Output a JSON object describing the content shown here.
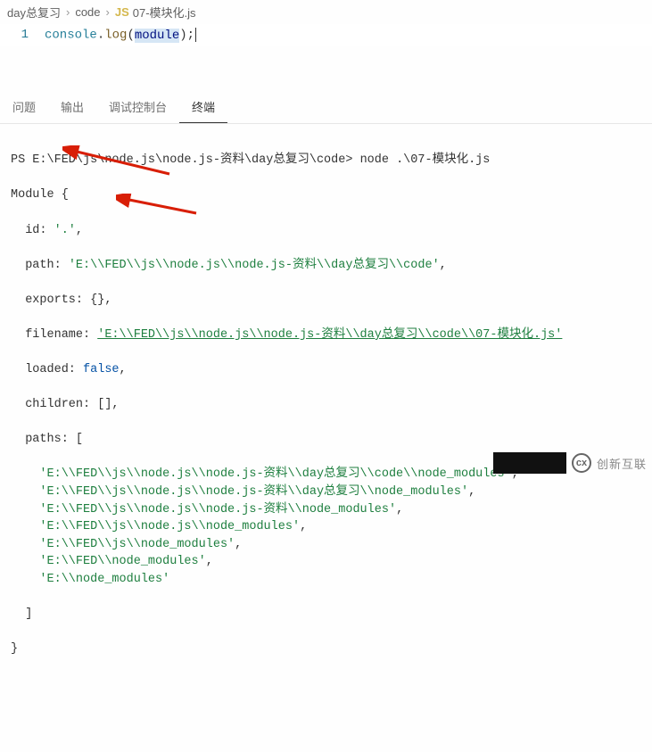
{
  "breadcrumb": {
    "segment1": "day总复习",
    "segment2": "code",
    "js_tag": "JS",
    "segment3": "07-模块化.js"
  },
  "editor": {
    "line_number": "1",
    "tok_console": "console",
    "tok_dot": ".",
    "tok_log": "log",
    "tok_lparen": "(",
    "tok_module": "module",
    "tok_rparen": ")",
    "tok_semi": ";"
  },
  "tabs": {
    "problems": "问题",
    "output": "输出",
    "debug_console": "调试控制台",
    "terminal": "终端"
  },
  "terminal": {
    "prompt": "PS E:\\FED\\js\\node.js\\node.js-资料\\day总复习\\code>",
    "command": "node .\\07-模块化.js",
    "out_module_open": "Module {",
    "out_id_key": "  id: ",
    "out_id_val": "'.'",
    "out_path_key": "  path: ",
    "out_path_val": "'E:\\\\FED\\\\js\\\\node.js\\\\node.js-资料\\\\day总复习\\\\code'",
    "out_exports": "  exports: {},",
    "out_filename_key": "  filename: ",
    "out_filename_val": "'E:\\\\FED\\\\js\\\\node.js\\\\node.js-资料\\\\day总复习\\\\code\\\\07-模块化.js'",
    "out_loaded_key": "  loaded: ",
    "out_loaded_val": "false",
    "out_children": "  children: [],",
    "out_paths_open": "  paths: [",
    "paths": [
      "'E:\\\\FED\\\\js\\\\node.js\\\\node.js-资料\\\\day总复习\\\\code\\\\node_modules'",
      "'E:\\\\FED\\\\js\\\\node.js\\\\node.js-资料\\\\day总复习\\\\node_modules'",
      "'E:\\\\FED\\\\js\\\\node.js\\\\node.js-资料\\\\node_modules'",
      "'E:\\\\FED\\\\js\\\\node.js\\\\node_modules'",
      "'E:\\\\FED\\\\js\\\\node_modules'",
      "'E:\\\\FED\\\\node_modules'",
      "'E:\\\\node_modules'"
    ],
    "out_paths_close": "  ]",
    "out_module_close": "}"
  },
  "watermark": {
    "text": "创新互联"
  }
}
